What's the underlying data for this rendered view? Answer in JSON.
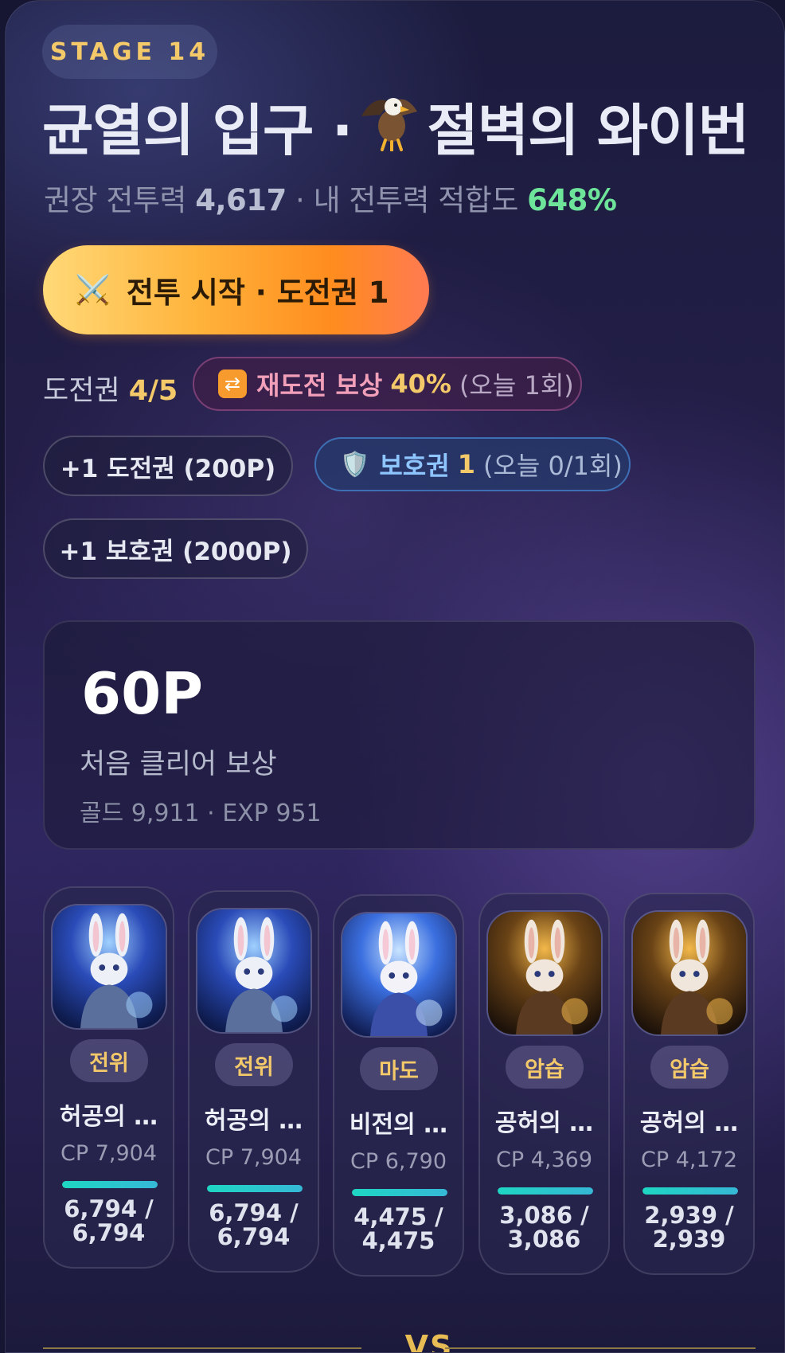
{
  "stage": {
    "label": "STAGE 14"
  },
  "title": {
    "part1": "균열의 입구 ·",
    "icon": "eagle-icon",
    "part2": "절벽의 와이번"
  },
  "power": {
    "rec_label": "권장 전투력",
    "rec_value": "4,617",
    "sep": "·",
    "fit_label": "내 전투력 적합도",
    "fit_value": "648%"
  },
  "battle_button": {
    "icon": "crossed-swords-icon",
    "label": "전투 시작 · 도전권 1"
  },
  "tickets": {
    "label": "도전권",
    "value": "4/5"
  },
  "retry_reward": {
    "icon": "repeat-icon",
    "label": "재도전 보상",
    "value": "40%",
    "note": "(오늘 1회)"
  },
  "buy_ticket": {
    "label": "+1 도전권 (200P)"
  },
  "shield": {
    "icon": "shield-icon",
    "label": "보호권",
    "value": "1",
    "note": "(오늘 0/1회)"
  },
  "buy_shield": {
    "label": "+1 보호권 (2000P)"
  },
  "reward": {
    "points": "60P",
    "label": "처음 클리어 보상",
    "sub": "골드 9,911 · EXP 951"
  },
  "heroes": [
    {
      "role": "전위",
      "name": "허공의 …",
      "cp": "CP 7,904",
      "hp": "6,794 /",
      "hp_max": "6,794",
      "hp_ratio": 1.0,
      "theme": "blue-knight"
    },
    {
      "role": "전위",
      "name": "허공의 …",
      "cp": "CP 7,904",
      "hp": "6,794 /",
      "hp_max": "6,794",
      "hp_ratio": 1.0,
      "theme": "blue-knight"
    },
    {
      "role": "마도",
      "name": "비전의 …",
      "cp": "CP 6,790",
      "hp": "4,475 /",
      "hp_max": "4,475",
      "hp_ratio": 1.0,
      "theme": "blue-mage"
    },
    {
      "role": "암습",
      "name": "공허의 …",
      "cp": "CP 4,369",
      "hp": "3,086 /",
      "hp_max": "3,086",
      "hp_ratio": 1.0,
      "theme": "gold-rogue"
    },
    {
      "role": "암습",
      "name": "공허의 …",
      "cp": "CP 4,172",
      "hp": "2,939 /",
      "hp_max": "2,939",
      "hp_ratio": 1.0,
      "theme": "gold-rogue"
    }
  ],
  "vs": {
    "label": "VS"
  },
  "colors": {
    "accent_gold": "#f3c969",
    "fit_green": "#6de49a",
    "hp_teal": "#1ed6c3"
  }
}
